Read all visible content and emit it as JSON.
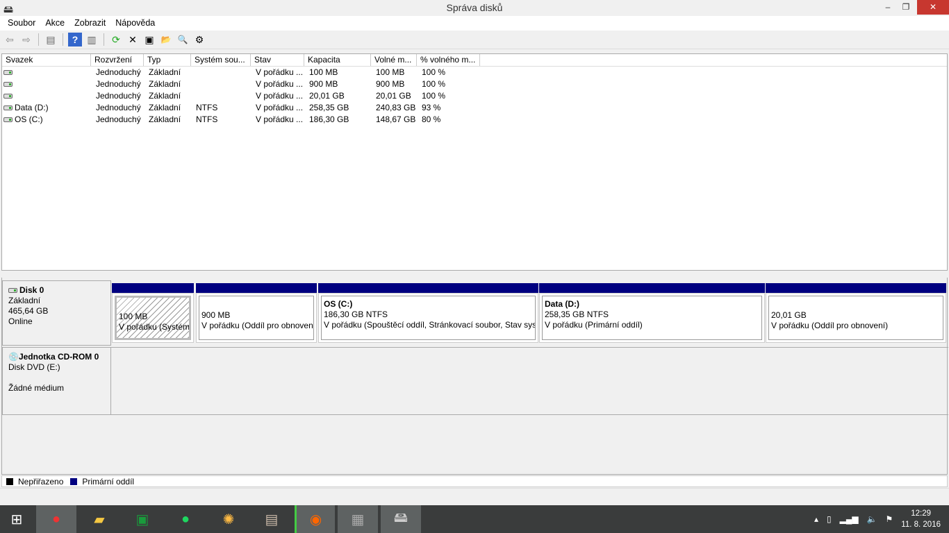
{
  "window": {
    "title": "Správa disků",
    "minimize": "–",
    "maximize": "❐",
    "close": "✕"
  },
  "menu": [
    "Soubor",
    "Akce",
    "Zobrazit",
    "Nápověda"
  ],
  "toolbar": {
    "icons": [
      "back-icon",
      "forward-icon",
      "console-tree-icon",
      "help-icon",
      "action-pane-icon",
      "refresh-icon",
      "delete-icon",
      "properties-icon",
      "open-icon",
      "explore-icon",
      "settings-icon"
    ],
    "glyphs": [
      "⇦",
      "⇨",
      "▤",
      "?",
      "▥",
      "⟳",
      "✕",
      "▣",
      "📂",
      "🔍",
      "⚙"
    ]
  },
  "table": {
    "columns": [
      "Svazek",
      "Rozvržení",
      "Typ",
      "Systém sou...",
      "Stav",
      "Kapacita",
      "Volné m...",
      "% volného m..."
    ],
    "rows": [
      [
        "",
        "Jednoduchý",
        "Základní",
        "",
        "V pořádku ...",
        "100 MB",
        "100 MB",
        "100 %"
      ],
      [
        "",
        "Jednoduchý",
        "Základní",
        "",
        "V pořádku ...",
        "900 MB",
        "900 MB",
        "100 %"
      ],
      [
        "",
        "Jednoduchý",
        "Základní",
        "",
        "V pořádku ...",
        "20,01 GB",
        "20,01 GB",
        "100 %"
      ],
      [
        "Data (D:)",
        "Jednoduchý",
        "Základní",
        "NTFS",
        "V pořádku ...",
        "258,35 GB",
        "240,83 GB",
        "93 %"
      ],
      [
        "OS (C:)",
        "Jednoduchý",
        "Základní",
        "NTFS",
        "V pořádku ...",
        "186,30 GB",
        "148,67 GB",
        "80 %"
      ]
    ]
  },
  "disk0": {
    "name": "Disk 0",
    "type": "Základní",
    "size": "465,64 GB",
    "status": "Online",
    "partitions": [
      {
        "title": "",
        "size": "100 MB",
        "status": "V pořádku (Systémový oddíl, Aktivní, Primární oddíl)"
      },
      {
        "title": "",
        "size": "900 MB",
        "status": "V pořádku (Oddíl pro obnovení)"
      },
      {
        "title": "OS  (C:)",
        "size": "186,30 GB NTFS",
        "status": "V pořádku (Spouštěcí oddíl, Stránkovací soubor, Stav systému)"
      },
      {
        "title": "Data  (D:)",
        "size": "258,35 GB NTFS",
        "status": "V pořádku (Primární oddíl)"
      },
      {
        "title": "",
        "size": "20,01 GB",
        "status": "V pořádku (Oddíl pro obnovení)"
      }
    ]
  },
  "cdrom": {
    "name": "Jednotka CD-ROM 0",
    "type": "Disk DVD (E:)",
    "status": "Žádné médium"
  },
  "legend": [
    {
      "label": "Nepřiřazeno",
      "color": "#000000"
    },
    {
      "label": "Primární oddíl",
      "color": "#000080"
    }
  ],
  "taskbar": {
    "apps": [
      "windows-start",
      "chrome",
      "file-explorer",
      "store",
      "spotify",
      "picasa",
      "notepad",
      "origin",
      "app-gray",
      "disk-management"
    ],
    "time": "12:29",
    "date": "11. 8. 2016"
  }
}
